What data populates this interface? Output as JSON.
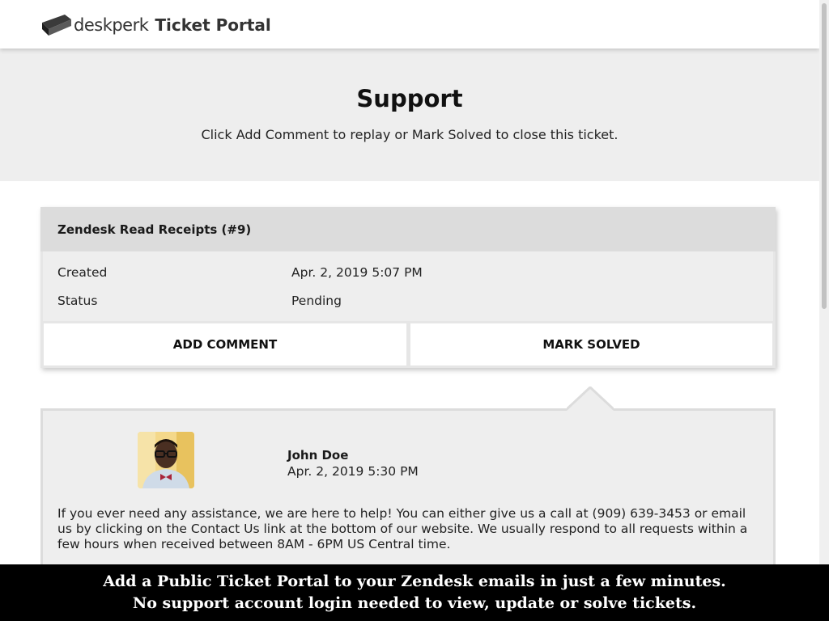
{
  "header": {
    "brand_name": "deskperk",
    "portal_title": "Ticket Portal"
  },
  "hero": {
    "title": "Support",
    "subtitle": "Click Add Comment to replay or Mark Solved to close this ticket."
  },
  "ticket": {
    "title": "Zendesk Read Receipts (#9)",
    "fields": [
      {
        "label": "Created",
        "value": "Apr. 2, 2019 5:07 PM"
      },
      {
        "label": "Status",
        "value": "Pending"
      }
    ],
    "add_comment_label": "ADD COMMENT",
    "mark_solved_label": "MARK SOLVED"
  },
  "comment": {
    "author": "John Doe",
    "date": "Apr. 2, 2019 5:30 PM",
    "body": "If you ever need any assistance, we are here to help!  You can either give us a call at (909) 639-3453 or email us by clicking on the Contact Us link at the bottom of our website.  We usually respond to all requests within a few hours when received between 8AM - 6PM US Central time."
  },
  "banner": {
    "line1": "Add a Public Ticket Portal to your Zendesk emails in just a few minutes.",
    "line2": "No support account login needed  to view, update or solve tickets."
  },
  "colors": {
    "hero_bg": "#eeeeee",
    "ticket_header_bg": "#dcdcdc",
    "banner_bg": "#000000"
  }
}
